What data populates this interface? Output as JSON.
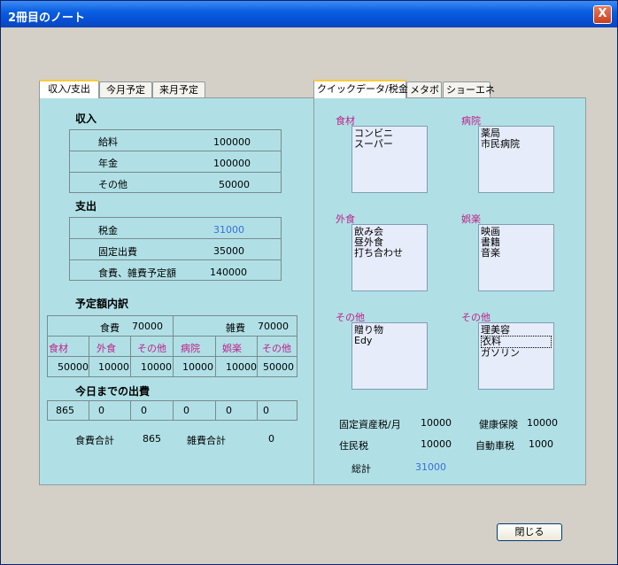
{
  "window": {
    "title": "2冊目のノート",
    "close_label": "X"
  },
  "left_tabs": [
    "収入/支出",
    "今月予定",
    "来月予定"
  ],
  "right_tabs": [
    "クイックデータ/税金",
    "メタボ",
    "ショーエネ"
  ],
  "income": {
    "heading": "収入",
    "rows": [
      {
        "label": "給料",
        "value": "100000"
      },
      {
        "label": "年金",
        "value": "100000"
      },
      {
        "label": "その他",
        "value": "50000"
      }
    ]
  },
  "expense": {
    "heading": "支出",
    "rows": [
      {
        "label": "税金",
        "value": "31000"
      },
      {
        "label": "固定出費",
        "value": "35000"
      },
      {
        "label": "食費、雑費予定額",
        "value": "140000"
      }
    ]
  },
  "budget": {
    "heading": "予定額内訳",
    "food_label": "食費",
    "food_value": "70000",
    "misc_label": "雑費",
    "misc_value": "70000",
    "columns": [
      "食材",
      "外食",
      "その他",
      "病院",
      "娯楽",
      "その他"
    ],
    "values": [
      "50000",
      "10000",
      "10000",
      "10000",
      "10000",
      "50000"
    ]
  },
  "spent": {
    "heading": "今日までの出費",
    "values": [
      "865",
      "0",
      "0",
      "0",
      "0",
      "0"
    ],
    "food_total_label": "食費合計",
    "food_total": "865",
    "misc_total_label": "雑費合計",
    "misc_total": "0"
  },
  "quick": {
    "groups": [
      {
        "label": "食材",
        "items": [
          "コンビニ",
          "スーパー"
        ]
      },
      {
        "label": "病院",
        "items": [
          "薬局",
          "市民病院"
        ]
      },
      {
        "label": "外食",
        "items": [
          "飲み会",
          "昼外食",
          "打ち合わせ"
        ]
      },
      {
        "label": "娯楽",
        "items": [
          "映画",
          "書籍",
          "音楽"
        ]
      },
      {
        "label": "その他",
        "items": [
          "贈り物",
          "Edy"
        ]
      },
      {
        "label": "その他",
        "items": [
          "理美容",
          "衣料",
          "ガソリン"
        ]
      }
    ]
  },
  "tax": {
    "fixed_asset_label": "固定資産税/月",
    "fixed_asset": "10000",
    "health_label": "健康保険",
    "health": "10000",
    "resident_label": "住民税",
    "resident": "10000",
    "car_label": "自動車税",
    "car": "1000",
    "total_label": "総計",
    "total": "31000"
  },
  "footer": {
    "close_button": "閉じる"
  },
  "colors": {
    "accent_pink": "#c0208a",
    "accent_blue": "#3a6fd8",
    "panel_bg": "#b0e0e6"
  }
}
